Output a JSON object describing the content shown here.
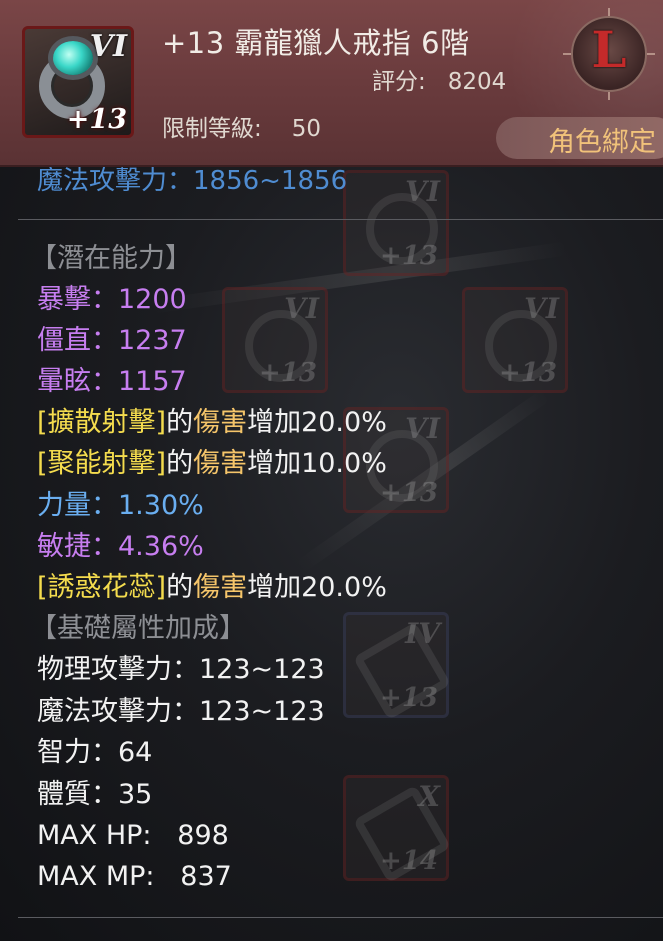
{
  "item": {
    "title": "+13 霸龍獵人戒指 6階",
    "score_label": "評分:",
    "score_value": "8204",
    "level_label": "限制等級:",
    "level_value": "50",
    "grade_badge": "VI",
    "enhance": "+13",
    "rarity_letter": "L",
    "bind_status": "角色綁定",
    "icon": "ring-with-teal-gem-icon"
  },
  "cut_off_line": "魔法攻擊力：1856~1856",
  "potential": {
    "heading": "【潛在能力】",
    "stats": [
      {
        "label": "暴擊：1200"
      },
      {
        "label": "僵直：1237"
      },
      {
        "label": "暈眩：1157"
      }
    ],
    "skill_bonuses": [
      {
        "skill": "[擴散射擊]",
        "of": "的",
        "damage": "傷害",
        "increase": "增加20.0%"
      },
      {
        "skill": "[聚能射擊]",
        "of": "的",
        "damage": "傷害",
        "increase": "增加10.0%"
      }
    ],
    "stat_percent_1": "力量：1.30%",
    "stat_percent_2": "敏捷：4.36%",
    "skill_bonus_3": {
      "skill": "[誘惑花蕊]",
      "of": "的",
      "damage": "傷害",
      "increase": "增加20.0%"
    }
  },
  "base": {
    "heading": "【基礎屬性加成】",
    "stats": [
      "物理攻擊力：123~123",
      "魔法攻擊力：123~123",
      "智力：64",
      "體質：35",
      "MAX HP:   898",
      "MAX MP:   837"
    ]
  },
  "background_slots": [
    {
      "grade": "VI",
      "plus": "+13"
    },
    {
      "grade": "VI",
      "plus": "+13"
    },
    {
      "grade": "VI",
      "plus": "+13"
    },
    {
      "grade": "VI",
      "plus": "+13"
    },
    {
      "grade": "IV",
      "plus": "+13"
    },
    {
      "grade": "X",
      "plus": "+14"
    }
  ],
  "colors": {
    "header_bg": "#6a3b3d",
    "potential_purple": "#c77ef0",
    "stat_blue": "#6aaef0",
    "skill_yellow": "#f4dc4e",
    "damage_orange": "#f5c56a",
    "section_gray": "#8d8f94",
    "bind_gold": "#f1c27a",
    "rarity_red": "#c42a2a"
  }
}
